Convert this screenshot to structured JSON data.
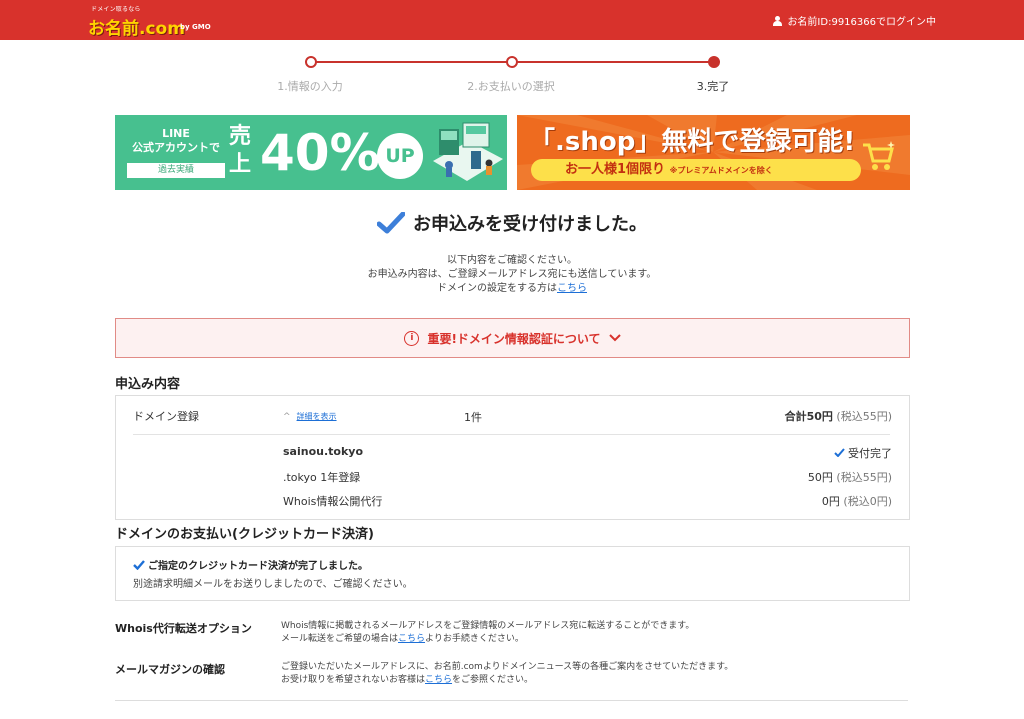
{
  "header": {
    "logo_tagline": "ドメイン取るなら",
    "logo_name": "お名前.com",
    "logo_brand": "by GMO",
    "login_status": "お名前ID:9916366でログイン中"
  },
  "steps": [
    {
      "label": "1.情報の入力",
      "current": false
    },
    {
      "label": "2.お支払いの選択",
      "current": false
    },
    {
      "label": "3.完了",
      "current": true
    }
  ],
  "banners": {
    "line": {
      "line1": "LINE",
      "line2": "公式アカウントで",
      "past": "過去実績",
      "sales": "売上",
      "percent": "40%",
      "up": "UP"
    },
    "shop": {
      "headline": "「.shop」無料で登録可能!",
      "pill_main": "お一人様1個限り",
      "pill_note": "※プレミアムドメインを除く"
    }
  },
  "completion": {
    "title": "お申込みを受け付けました。",
    "line1": "以下内容をご確認ください。",
    "line2": "お申込み内容は、ご登録メールアドレス宛にも送信しています。",
    "line3_prefix": "ドメインの設定をする方は",
    "line3_link": "こちら"
  },
  "alert": {
    "text": "重要!ドメイン情報認証について"
  },
  "order": {
    "section_title": "申込み内容",
    "category": "ドメイン登録",
    "detail_link": "詳細を表示",
    "count": "1件",
    "total": "合計50円",
    "total_tax": "(税込55円)",
    "domain": "sainou.tokyo",
    "status": "受付完了",
    "items": [
      {
        "name": ".tokyo 1年登録",
        "price": "50円",
        "tax": "(税込55円)"
      },
      {
        "name": "Whois情報公開代行",
        "price": "0円",
        "tax": "(税込0円)"
      }
    ]
  },
  "payment": {
    "section_title": "ドメインのお支払い(クレジットカード決済)",
    "line1": "ご指定のクレジットカード決済が完了しました。",
    "line2": "別途請求明細メールをお送りしましたので、ご確認ください。"
  },
  "options": [
    {
      "label": "Whois代行転送オプション",
      "line1": "Whois情報に掲載されるメールアドレスをご登録情報のメールアドレス宛に転送することができます。",
      "line2_prefix": "メール転送をご希望の場合は",
      "line2_link": "こちら",
      "line2_suffix": "よりお手続きください。"
    },
    {
      "label": "メールマガジンの確認",
      "line1": "ご登録いただいたメールアドレスに、お名前.comよりドメインニュース等の各種ご案内をさせていただきます。",
      "line2_prefix": "お受け取りを希望されないお客様は",
      "line2_link": "こちら",
      "line2_suffix": "をご参照ください。"
    }
  ],
  "colors": {
    "header_red": "#d8322c",
    "link_blue": "#1d6fd6",
    "banner_green": "#47c08f",
    "banner_orange": "#ee6b1f"
  }
}
